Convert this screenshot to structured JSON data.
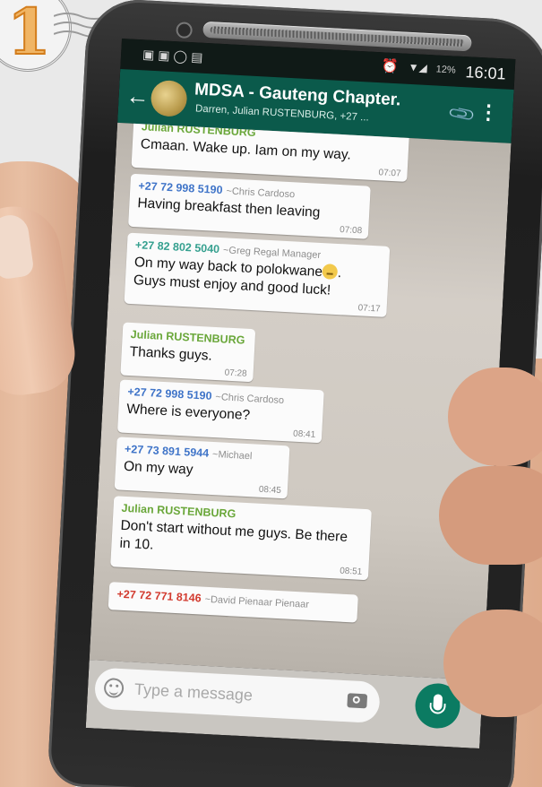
{
  "decor": {
    "corner_number": "1"
  },
  "statusbar": {
    "battery": "12%",
    "time": "16:01"
  },
  "header": {
    "title": "MDSA - Gauteng Chapter.",
    "subtitle": "Darren, Julian RUSTENBURG, +27 ..."
  },
  "messages": [
    {
      "sender": "Julian RUSTENBURG",
      "alias": "",
      "text": "Cmaan. Wake up. Iam on my way.",
      "time": "07:07"
    },
    {
      "sender": "+27 72 998 5190",
      "alias": "~Chris Cardoso",
      "text": "Having breakfast then leaving",
      "time": "07:08"
    },
    {
      "sender": "+27 82 802 5040",
      "alias": "~Greg Regal Manager",
      "text": "On my way back to polokwane",
      "text2": "Guys must enjoy and good luck!",
      "time": "07:17"
    },
    {
      "sender": "Julian RUSTENBURG",
      "alias": "",
      "text": "Thanks guys.",
      "time": "07:28"
    },
    {
      "sender": "+27 72 998 5190",
      "alias": "~Chris Cardoso",
      "text": "Where is everyone?",
      "time": "08:41"
    },
    {
      "sender": "+27 73 891 5944",
      "alias": "~Michael",
      "text": "On my way",
      "time": "08:45"
    },
    {
      "sender": "Julian RUSTENBURG",
      "alias": "",
      "text": "Don't start without me guys. Be there in 10.",
      "time": "08:51"
    },
    {
      "sender": "+27 72 771 8146",
      "alias": "~David Pienaar Pienaar",
      "text": "",
      "time": ""
    }
  ],
  "input": {
    "placeholder": "Type a message"
  },
  "colors": {
    "appbar": "#0b5a4b",
    "mic_button": "#0b7b62",
    "bubble": "#fbfbfb"
  }
}
